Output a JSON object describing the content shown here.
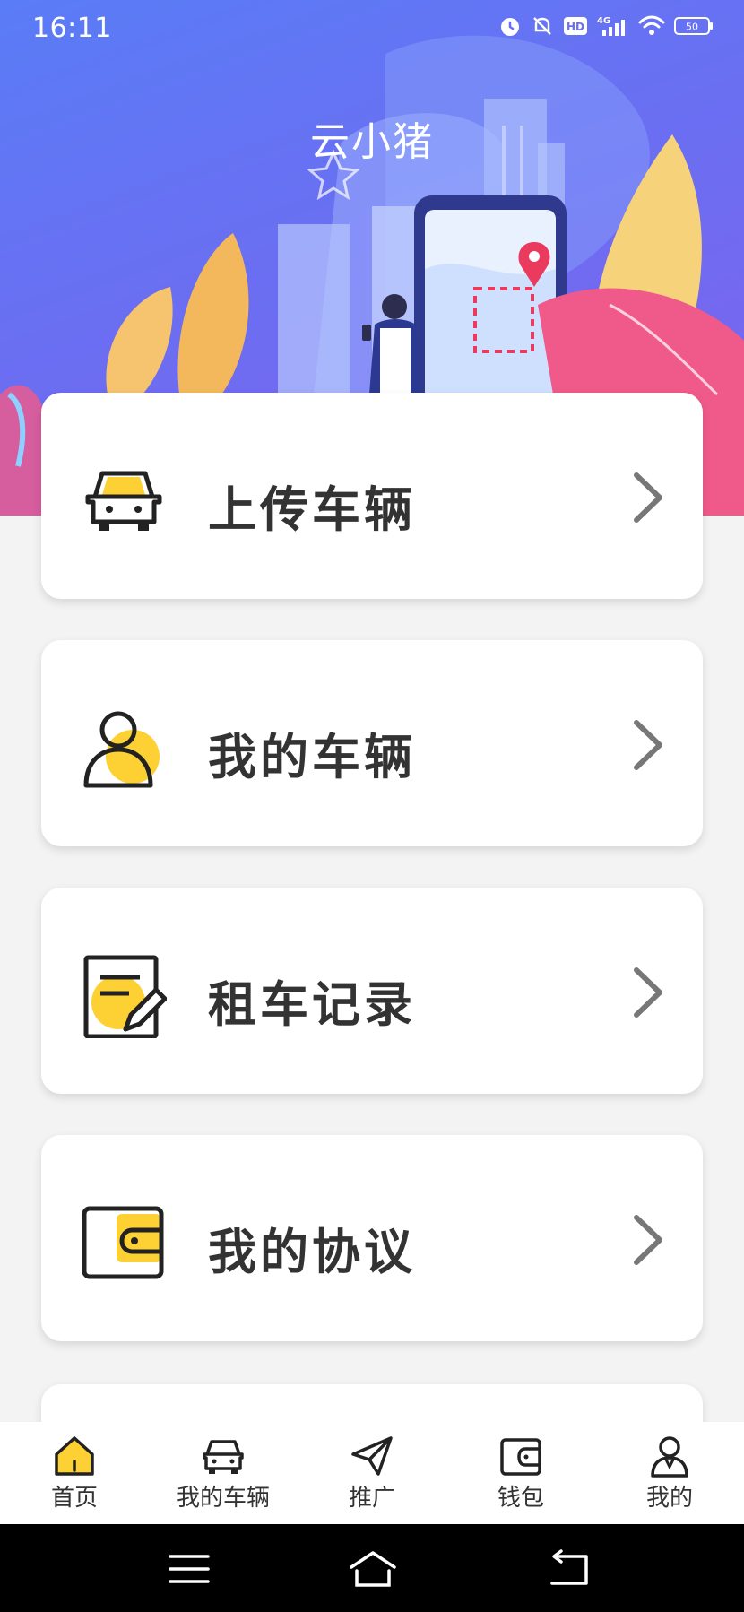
{
  "status_bar": {
    "time": "16:11",
    "network": "4G",
    "hd_badge": "HD",
    "battery": "50",
    "icons": [
      "alarm-icon",
      "mute-icon",
      "hd-icon",
      "signal-icon",
      "wifi-icon",
      "battery-icon"
    ]
  },
  "header": {
    "title": "云小猪"
  },
  "menu": {
    "items": [
      {
        "label": "上传车辆",
        "icon": "car-icon"
      },
      {
        "label": "我的车辆",
        "icon": "person-icon"
      },
      {
        "label": "租车记录",
        "icon": "document-edit-icon"
      },
      {
        "label": "我的协议",
        "icon": "wallet-icon"
      }
    ]
  },
  "tabbar": {
    "items": [
      {
        "label": "首页",
        "icon": "home-icon",
        "active": true
      },
      {
        "label": "我的车辆",
        "icon": "car-icon"
      },
      {
        "label": "推广",
        "icon": "send-icon"
      },
      {
        "label": "钱包",
        "icon": "wallet-icon"
      },
      {
        "label": "我的",
        "icon": "user-icon"
      }
    ]
  },
  "system_nav": {
    "buttons": [
      "menu-icon",
      "home-icon",
      "back-icon"
    ]
  },
  "colors": {
    "accent_yellow": "#fdd033",
    "header_blue": "#5a7cf6",
    "header_purple": "#7e62ee",
    "text_dark": "#333333"
  }
}
